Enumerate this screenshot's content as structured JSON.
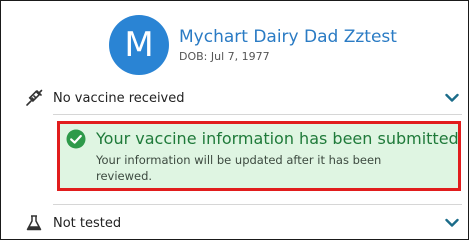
{
  "patient": {
    "avatar_initial": "M",
    "name": "Mychart Dairy Dad Zztest",
    "dob": "DOB: Jul 7, 1977"
  },
  "vaccine_row": {
    "icon": "syringe-icon",
    "label": "No vaccine received"
  },
  "banner": {
    "icon": "check-circle-icon",
    "title": "Your vaccine information has been submitted",
    "body": "Your information will be updated after it has been reviewed."
  },
  "test_row": {
    "icon": "flask-icon",
    "label": "Not tested"
  },
  "colors": {
    "avatar": "#2a84d4",
    "name": "#2a7bc4",
    "chevron": "#1b6c8a",
    "banner_bg": "#dff5e2",
    "banner_title": "#1f7a3a",
    "highlight_border": "#e11d1d"
  }
}
